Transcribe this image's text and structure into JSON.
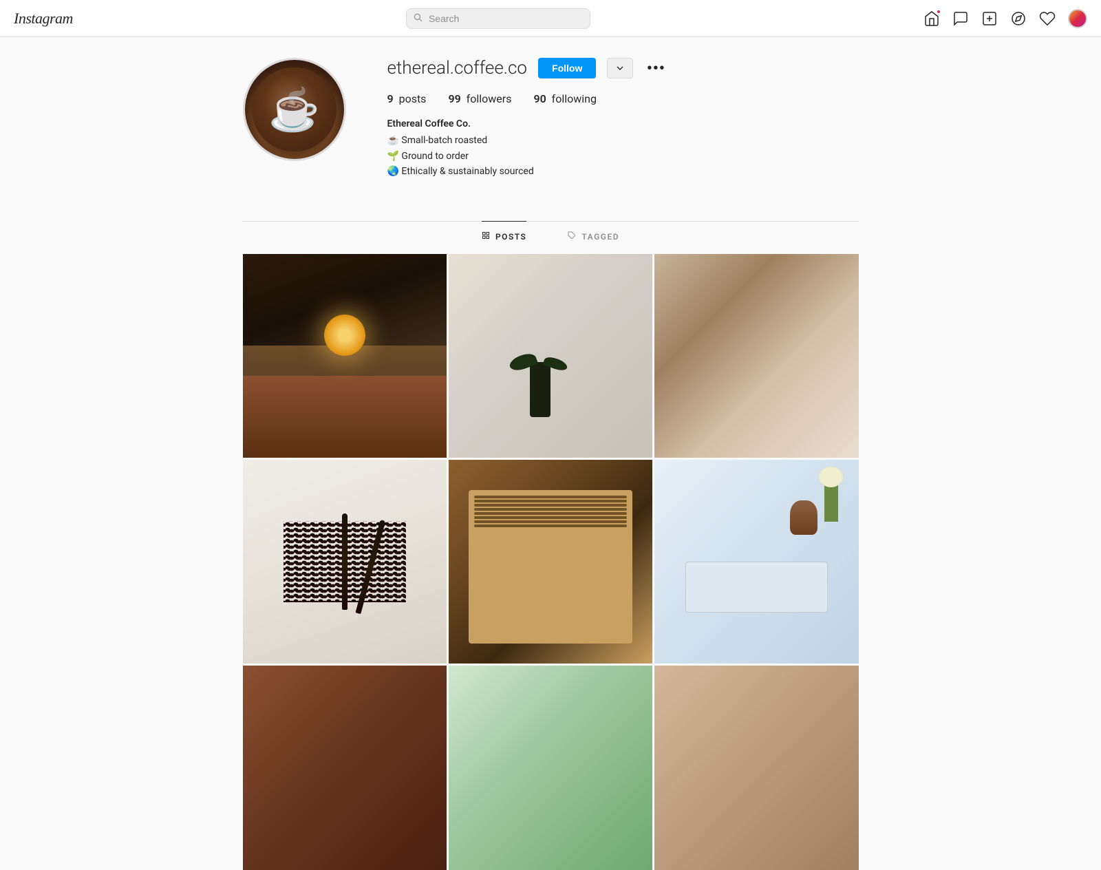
{
  "header": {
    "logo": "Instagram",
    "search_placeholder": "Search",
    "nav_icons": [
      "home",
      "messenger",
      "create",
      "compass",
      "heart",
      "profile"
    ]
  },
  "profile": {
    "username": "ethereal.coffee.co",
    "follow_label": "Follow",
    "dropdown_symbol": "▾",
    "more_symbol": "•••",
    "stats": {
      "posts_count": "9",
      "posts_label": "posts",
      "followers_count": "99",
      "followers_label": "followers",
      "following_count": "90",
      "following_label": "following"
    },
    "bio": {
      "name": "Ethereal Coffee Co.",
      "line1": "☕ Small-batch roasted",
      "line2": "🌱 Ground to order",
      "line3": "🌏 Ethically & sustainably sourced"
    }
  },
  "tabs": [
    {
      "id": "posts",
      "icon": "grid",
      "label": "POSTS",
      "active": true
    },
    {
      "id": "tagged",
      "icon": "tag",
      "label": "TAGGED",
      "active": false
    }
  ],
  "grid": {
    "photos": [
      {
        "id": 1,
        "type": "coffee-bar"
      },
      {
        "id": 2,
        "type": "plant-table"
      },
      {
        "id": 3,
        "type": "cafe-interior"
      },
      {
        "id": 4,
        "type": "coffee-spoons"
      },
      {
        "id": 5,
        "type": "menu-board"
      },
      {
        "id": 6,
        "type": "desk-tulip"
      },
      {
        "id": 7,
        "type": "partial-left"
      },
      {
        "id": 8,
        "type": "partial-mid"
      },
      {
        "id": 9,
        "type": "partial-right"
      }
    ]
  }
}
